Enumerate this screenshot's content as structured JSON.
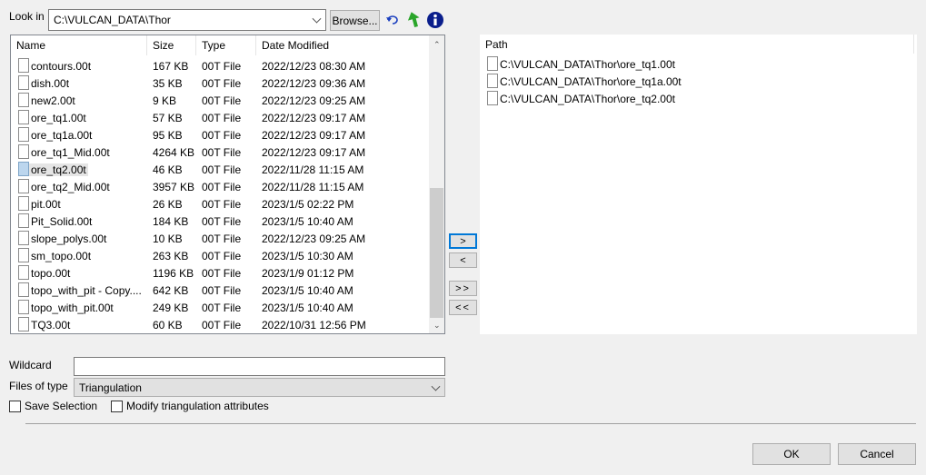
{
  "look_in": {
    "label": "Look in",
    "value": "C:\\VULCAN_DATA\\Thor",
    "browse": "Browse..."
  },
  "toolbar": {
    "back_icon": "undo-arrow-icon",
    "up_icon": "green-up-arrow-icon",
    "info_icon": "info-icon"
  },
  "file_list": {
    "columns": [
      "Name",
      "Size",
      "Type",
      "Date Modified"
    ],
    "rows": [
      {
        "name": "contours.00t",
        "size": "167 KB",
        "type": "00T File",
        "date": "2022/12/23 08:30 AM"
      },
      {
        "name": "dish.00t",
        "size": "35 KB",
        "type": "00T File",
        "date": "2022/12/23 09:36 AM"
      },
      {
        "name": "new2.00t",
        "size": "9 KB",
        "type": "00T File",
        "date": "2022/12/23 09:25 AM"
      },
      {
        "name": "ore_tq1.00t",
        "size": "57 KB",
        "type": "00T File",
        "date": "2022/12/23 09:17 AM"
      },
      {
        "name": "ore_tq1a.00t",
        "size": "95 KB",
        "type": "00T File",
        "date": "2022/12/23 09:17 AM"
      },
      {
        "name": "ore_tq1_Mid.00t",
        "size": "4264 KB",
        "type": "00T File",
        "date": "2022/12/23 09:17 AM"
      },
      {
        "name": "ore_tq2.00t",
        "size": "46 KB",
        "type": "00T File",
        "date": "2022/11/28 11:15 AM",
        "selected": true
      },
      {
        "name": "ore_tq2_Mid.00t",
        "size": "3957 KB",
        "type": "00T File",
        "date": "2022/11/28 11:15 AM"
      },
      {
        "name": "pit.00t",
        "size": "26 KB",
        "type": "00T File",
        "date": "2023/1/5 02:22 PM"
      },
      {
        "name": "Pit_Solid.00t",
        "size": "184 KB",
        "type": "00T File",
        "date": "2023/1/5 10:40 AM"
      },
      {
        "name": "slope_polys.00t",
        "size": "10 KB",
        "type": "00T File",
        "date": "2022/12/23 09:25 AM"
      },
      {
        "name": "sm_topo.00t",
        "size": "263 KB",
        "type": "00T File",
        "date": "2023/1/5 10:30 AM"
      },
      {
        "name": "topo.00t",
        "size": "1196 KB",
        "type": "00T File",
        "date": "2023/1/9 01:12 PM"
      },
      {
        "name": "topo_with_pit - Copy....",
        "size": "642 KB",
        "type": "00T File",
        "date": "2023/1/5 10:40 AM"
      },
      {
        "name": "topo_with_pit.00t",
        "size": "249 KB",
        "type": "00T File",
        "date": "2023/1/5 10:40 AM"
      },
      {
        "name": "TQ3.00t",
        "size": "60 KB",
        "type": "00T File",
        "date": "2022/10/31 12:56 PM"
      }
    ],
    "scroll_position": 0.75
  },
  "transfer": {
    "add": ">",
    "remove": "<",
    "add_all": ">>",
    "remove_all": "<<"
  },
  "selected": {
    "column": "Path",
    "rows": [
      "C:\\VULCAN_DATA\\Thor\\ore_tq1.00t",
      "C:\\VULCAN_DATA\\Thor\\ore_tq1a.00t",
      "C:\\VULCAN_DATA\\Thor\\ore_tq2.00t"
    ]
  },
  "wildcard": {
    "label": "Wildcard",
    "value": ""
  },
  "files_of_type": {
    "label": "Files of type",
    "value": "Triangulation"
  },
  "options": {
    "save_selection": {
      "label": "Save Selection",
      "checked": false
    },
    "modify": {
      "label": "Modify triangulation attributes",
      "checked": false
    }
  },
  "footer": {
    "ok": "OK",
    "cancel": "Cancel"
  }
}
